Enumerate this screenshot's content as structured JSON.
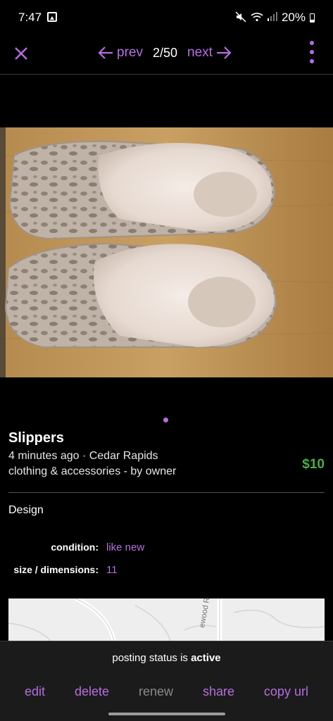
{
  "status_bar": {
    "time": "7:47",
    "battery": "20%"
  },
  "toolbar": {
    "prev_label": "prev",
    "counter": "2/50",
    "next_label": "next",
    "accent_color": "#b66ee0"
  },
  "listing": {
    "title": "Slippers",
    "posted_line": "4 minutes ago · Cedar Rapids",
    "category_line": "clothing & accessories - by owner",
    "price": "$10",
    "price_color": "#4cae4c",
    "body": "Design",
    "attributes": [
      {
        "label": "condition:",
        "value": "like new"
      },
      {
        "label": "size / dimensions:",
        "value": "11"
      }
    ]
  },
  "map": {
    "street_label": "ewood R"
  },
  "bottom_bar": {
    "status_prefix": "posting status is",
    "status_value": "active",
    "actions": [
      {
        "label": "edit",
        "enabled": true
      },
      {
        "label": "delete",
        "enabled": true
      },
      {
        "label": "renew",
        "enabled": false
      },
      {
        "label": "share",
        "enabled": true
      },
      {
        "label": "copy url",
        "enabled": true
      }
    ]
  }
}
